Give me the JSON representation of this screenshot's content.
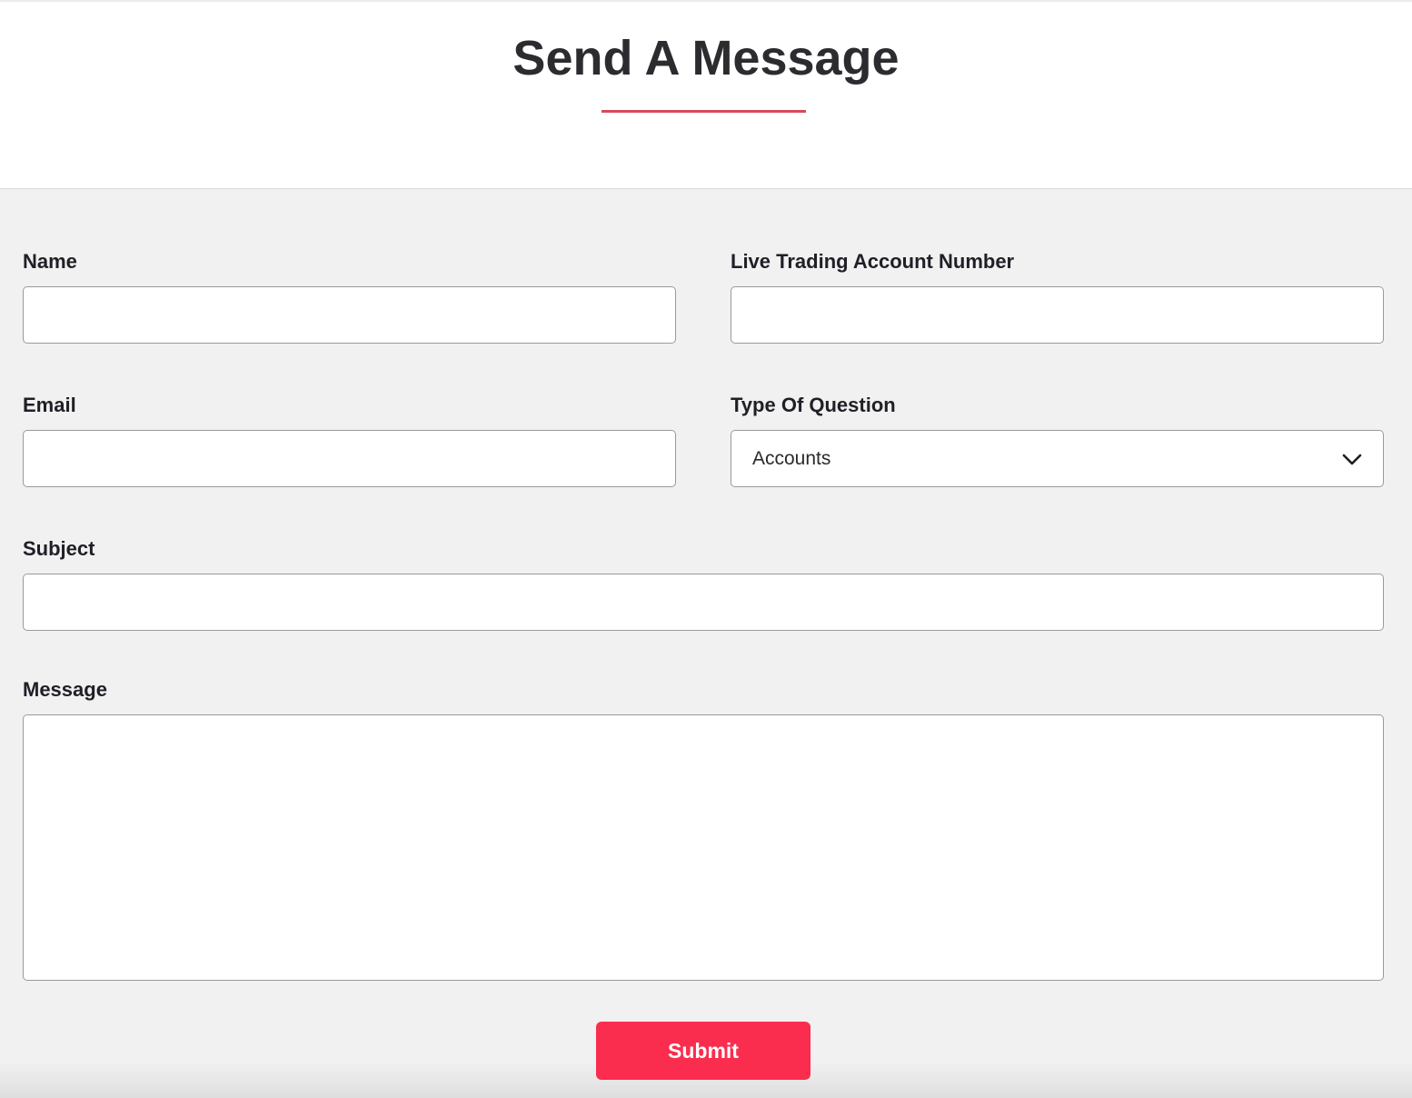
{
  "header": {
    "title": "Send A Message"
  },
  "form": {
    "name_label": "Name",
    "name_value": "",
    "account_label": "Live Trading Account Number",
    "account_value": "",
    "email_label": "Email",
    "email_value": "",
    "question_type_label": "Type Of Question",
    "question_type_selected": "Accounts",
    "subject_label": "Subject",
    "subject_value": "",
    "message_label": "Message",
    "message_value": "",
    "submit_label": "Submit"
  },
  "icons": {
    "dropdown": "chevron-down-icon"
  },
  "colors": {
    "accent": "#fb2d4e",
    "underline": "#d8475e",
    "form_background": "#f1f1f1"
  }
}
